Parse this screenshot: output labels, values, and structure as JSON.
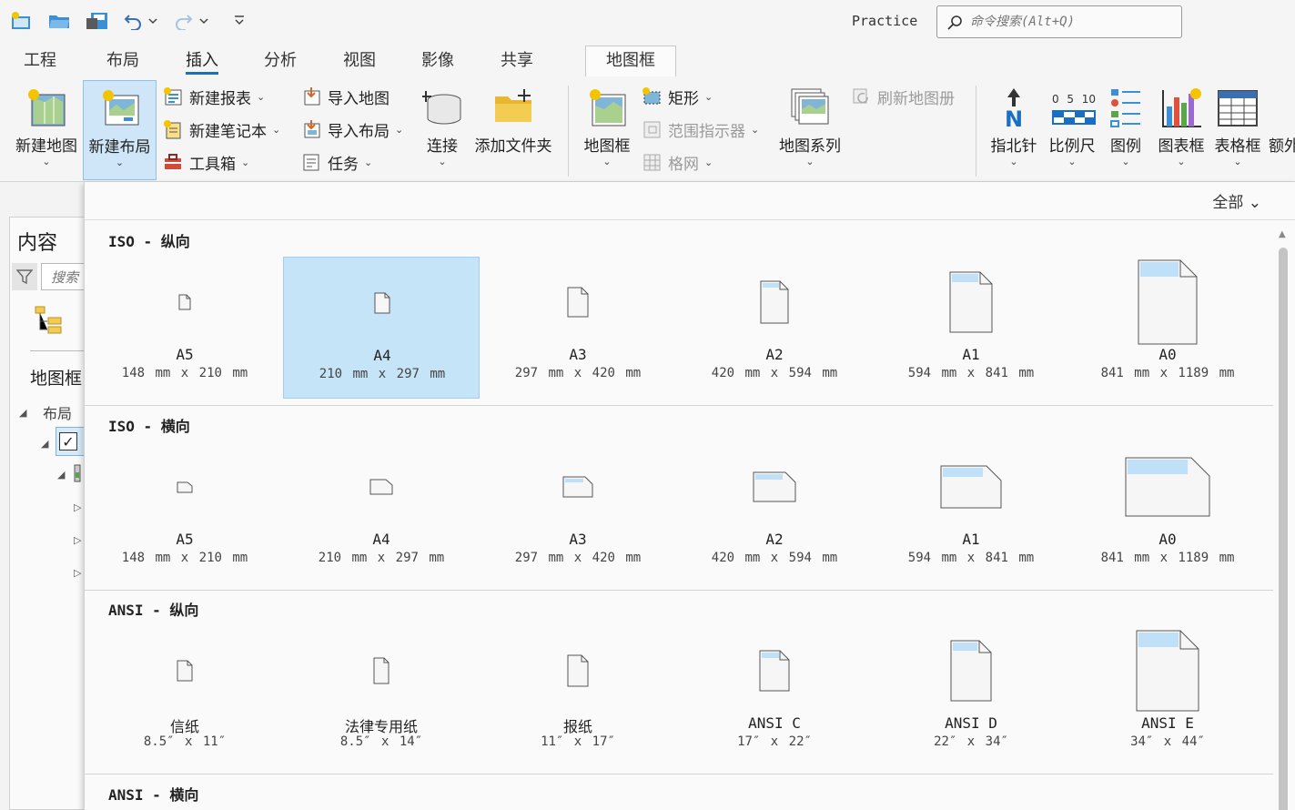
{
  "titlebar": {
    "project_name": "Practice",
    "search_placeholder": "命令搜索(Alt+Q)"
  },
  "tabs": [
    {
      "label": "工程"
    },
    {
      "label": "布局"
    },
    {
      "label": "插入"
    },
    {
      "label": "分析"
    },
    {
      "label": "视图"
    },
    {
      "label": "影像"
    },
    {
      "label": "共享"
    },
    {
      "label": "地图框"
    }
  ],
  "active_tab": "插入",
  "ribbon": {
    "new_map": "新建地图",
    "new_layout": "新建布局",
    "new_report": "新建报表",
    "new_notebook": "新建笔记本",
    "toolbox": "工具箱",
    "import_map": "导入地图",
    "import_layout": "导入布局",
    "task": "任务",
    "connect": "连接",
    "add_folder": "添加文件夹",
    "map_frame": "地图框",
    "rectangle": "矩形",
    "extent_indicator": "范围指示器",
    "grid": "格网",
    "map_series": "地图系列",
    "refresh_atlas": "刷新地图册",
    "north_arrow": "指北针",
    "scale_bar": "比例尺",
    "legend": "图例",
    "chart_frame": "图表框",
    "table_frame": "表格框",
    "extra": "额外",
    "scale_numbers": [
      "0",
      "5",
      "10"
    ]
  },
  "contents_pane": {
    "title": "内容",
    "search_placeholder": "搜索",
    "map_frame_heading": "地图框",
    "layout_label": "布局"
  },
  "gallery": {
    "filter_label": "全部",
    "sections": [
      {
        "title": "ISO - 纵向",
        "items": [
          {
            "name": "A5",
            "size": "148 mm x 210 mm"
          },
          {
            "name": "A4",
            "size": "210 mm x 297 mm"
          },
          {
            "name": "A3",
            "size": "297 mm x 420 mm"
          },
          {
            "name": "A2",
            "size": "420 mm x 594 mm"
          },
          {
            "name": "A1",
            "size": "594 mm x 841 mm"
          },
          {
            "name": "A0",
            "size": "841 mm x 1189 mm"
          }
        ]
      },
      {
        "title": "ISO - 横向",
        "items": [
          {
            "name": "A5",
            "size": "148 mm x 210 mm"
          },
          {
            "name": "A4",
            "size": "210 mm x 297 mm"
          },
          {
            "name": "A3",
            "size": "297 mm x 420 mm"
          },
          {
            "name": "A2",
            "size": "420 mm x 594 mm"
          },
          {
            "name": "A1",
            "size": "594 mm x 841 mm"
          },
          {
            "name": "A0",
            "size": "841 mm x 1189 mm"
          }
        ]
      },
      {
        "title": "ANSI - 纵向",
        "items": [
          {
            "name": "信纸",
            "size": "8.5″ x 11″"
          },
          {
            "name": "法律专用纸",
            "size": "8.5″ x 14″"
          },
          {
            "name": "报纸",
            "size": "11″ x 17″"
          },
          {
            "name": "ANSI C",
            "size": "17″ x 22″"
          },
          {
            "name": "ANSI D",
            "size": "22″ x 34″"
          },
          {
            "name": "ANSI E",
            "size": "34″ x 44″"
          }
        ]
      },
      {
        "title": "ANSI - 横向",
        "items": []
      }
    ]
  },
  "colors": {
    "accent": "#1a6fc5",
    "selected_bg": "#c6e4f8",
    "pressed_bg": "#cfe6f8"
  }
}
